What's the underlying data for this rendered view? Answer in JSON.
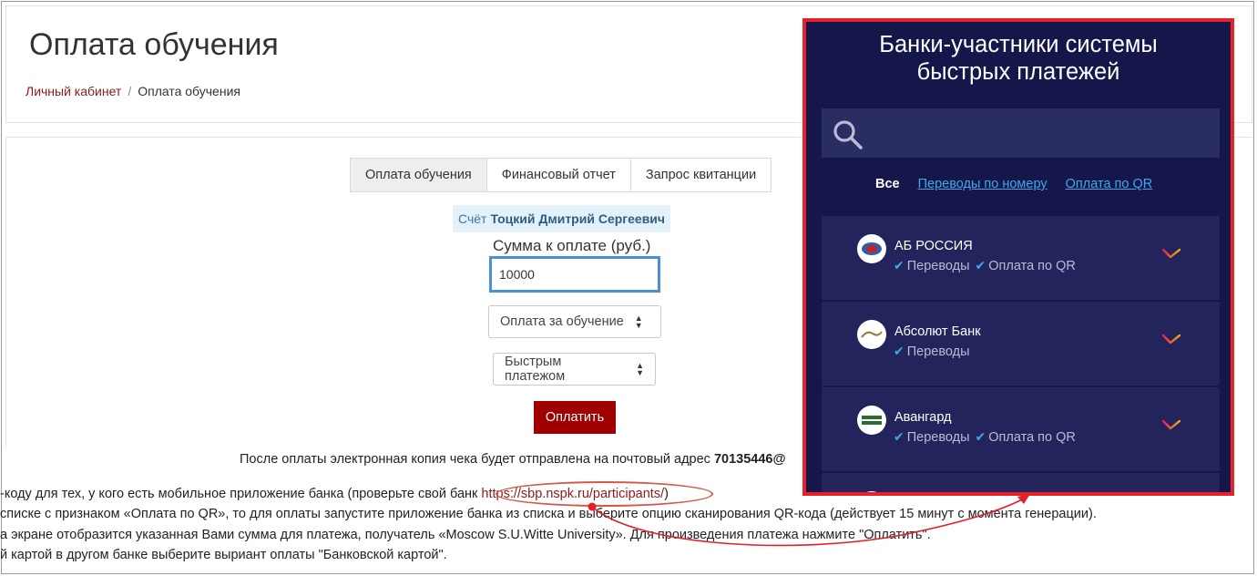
{
  "page": {
    "title": "Оплата обучения",
    "breadcrumb": {
      "home": "Личный кабинет",
      "separator": "/",
      "current": "Оплата обучения"
    }
  },
  "tabs": [
    "Оплата обучения",
    "Финансовый отчет",
    "Запрос квитанции"
  ],
  "form": {
    "account_label": "Счёт",
    "account_name": "Тоцкий Дмитрий Сергеевич",
    "sum_label": "Сумма к оплате (руб.)",
    "sum_value": "10000",
    "purpose_select": "Оплата за обучение",
    "method_select": "Быстрым платежом",
    "pay_button": "Оплатить",
    "after_text": "После оплаты электронная копия чека будет отправлена на почтовый адрес",
    "after_email": "70135446@"
  },
  "info": {
    "line1_a": "-коду для тех, у кого есть мобильное приложение банка (проверьте свой банк ",
    "line1_link": "https://sbp.nspk.ru/participants/",
    "line1_b": ")",
    "line2": " списке с признаком «Оплата по QR», то для оплаты запустите приложение банка из списка и выберите опцию сканирования QR-кода (действует 15 минут с момента генерации).",
    "line3": "а экране отобразится указанная Вами сумма для платежа, получатель «Moscow S.U.Witte University». Для произведения платежа нажмите \"Оплатить\".",
    "line4": "й картой в другом банке выберите выриант оплаты \"Банковской картой\"."
  },
  "sbp": {
    "title_line1": "Банки-участники системы",
    "title_line2": "быстрых платежей",
    "filters": [
      "Все",
      "Переводы по номеру",
      "Оплата по QR"
    ],
    "banks": [
      {
        "name": "АБ РОССИЯ",
        "features": [
          "Переводы",
          "Оплата по QR"
        ]
      },
      {
        "name": "Абсолют Банк",
        "features": [
          "Переводы"
        ]
      },
      {
        "name": "Авангард",
        "features": [
          "Переводы",
          "Оплата по QR"
        ]
      }
    ]
  },
  "colors": {
    "link": "#8b1a1a",
    "pay_button": "#a00000",
    "sbp_background": "#15174a",
    "sbp_card": "#23245b",
    "sbp_border": "#e8202a",
    "annotation": "#d25a4a",
    "focus": "#4a90d9"
  },
  "icons": {
    "search": "search-icon",
    "check": "check-icon",
    "select_arrows": "select-arrows-icon",
    "bank_chevron": "chevron-down-icon"
  }
}
